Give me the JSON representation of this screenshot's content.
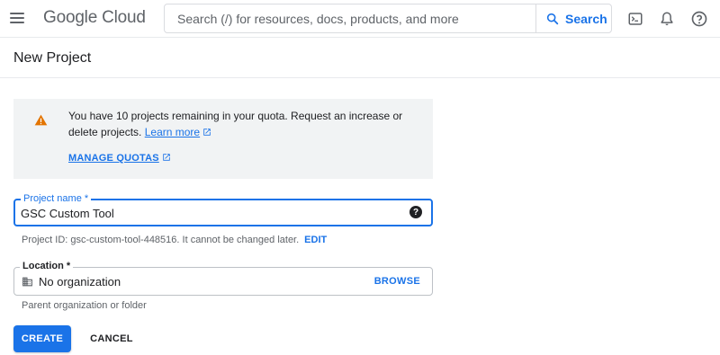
{
  "header": {
    "logo_google": "Google",
    "logo_cloud": "Cloud",
    "search_placeholder": "Search (/) for resources, docs, products, and more",
    "search_button": "Search"
  },
  "page": {
    "title": "New Project"
  },
  "notice": {
    "text": "You have 10 projects remaining in your quota. Request an increase or delete projects.",
    "learn_more": "Learn more",
    "manage_quotas": "MANAGE QUOTAS"
  },
  "project_name": {
    "label": "Project name *",
    "value": "GSC Custom Tool",
    "helper": "Project ID: gsc-custom-tool-448516. It cannot be changed later.",
    "edit": "EDIT"
  },
  "location": {
    "label": "Location *",
    "value": "No organization",
    "browse": "BROWSE",
    "helper": "Parent organization or folder"
  },
  "actions": {
    "create": "CREATE",
    "cancel": "CANCEL"
  },
  "colors": {
    "primary": "#1a73e8",
    "warning": "#e37400",
    "notice_bg": "#f1f3f4"
  },
  "icons": [
    "menu-icon",
    "search-icon",
    "cloud-shell-icon",
    "notifications-icon",
    "help-icon",
    "warning-icon",
    "external-link-icon",
    "organization-icon"
  ]
}
